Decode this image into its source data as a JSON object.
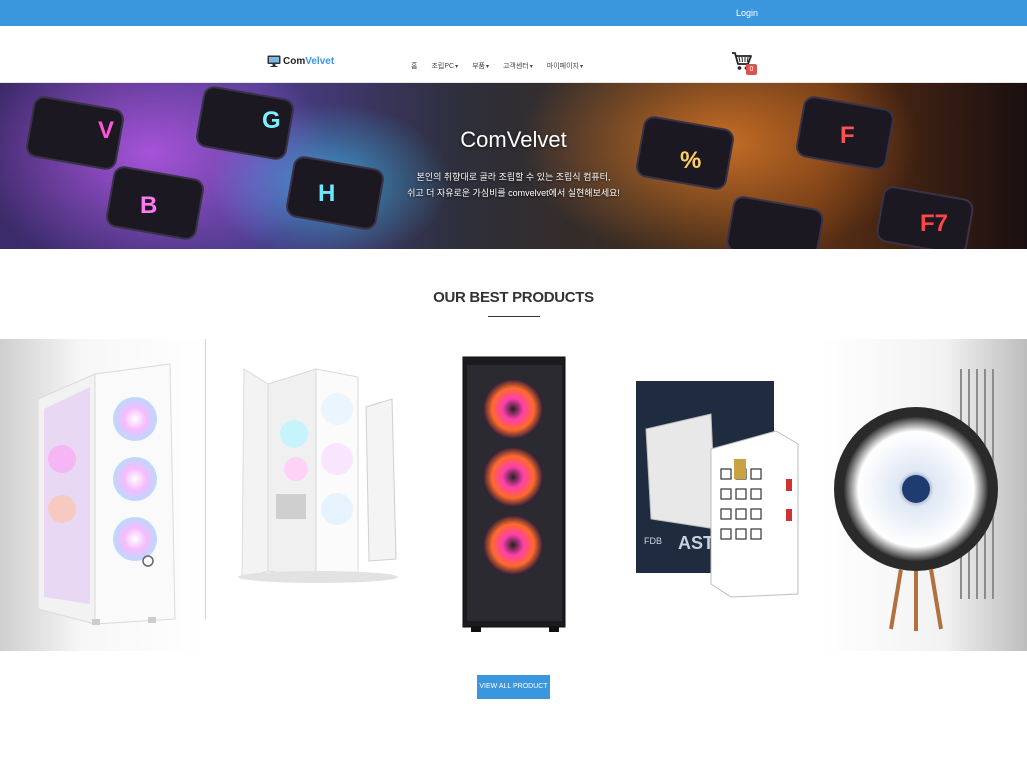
{
  "topbar": {
    "login_label": "Login"
  },
  "header": {
    "logo_part1": "Com",
    "logo_part2": "Velvet",
    "nav": [
      {
        "label": "홈",
        "dropdown": false
      },
      {
        "label": "조립PC",
        "dropdown": true
      },
      {
        "label": "부품",
        "dropdown": true
      },
      {
        "label": "고객센터",
        "dropdown": true
      },
      {
        "label": "마이페이지",
        "dropdown": true
      }
    ],
    "cart_count": "0"
  },
  "hero": {
    "title": "ComVelvet",
    "line1": "본인의 취향대로 골라 조립할 수 있는 조립식 컴퓨터,",
    "line2": "쉬고 더 자유로운 가심비를 comvelvet에서 실현해보세요!"
  },
  "best": {
    "heading": "OUR BEST PRODUCTS",
    "products": [
      {
        "name": "white-mesh-pc-case"
      },
      {
        "name": "white-open-pc-case"
      },
      {
        "name": "black-rgb-pc-case"
      },
      {
        "name": "astro-power-supply"
      },
      {
        "name": "cpu-tower-cooler"
      }
    ],
    "button_label": "VIEW ALL PRODUCT"
  },
  "colors": {
    "accent": "#3a96dd",
    "badge": "#d9534f"
  }
}
